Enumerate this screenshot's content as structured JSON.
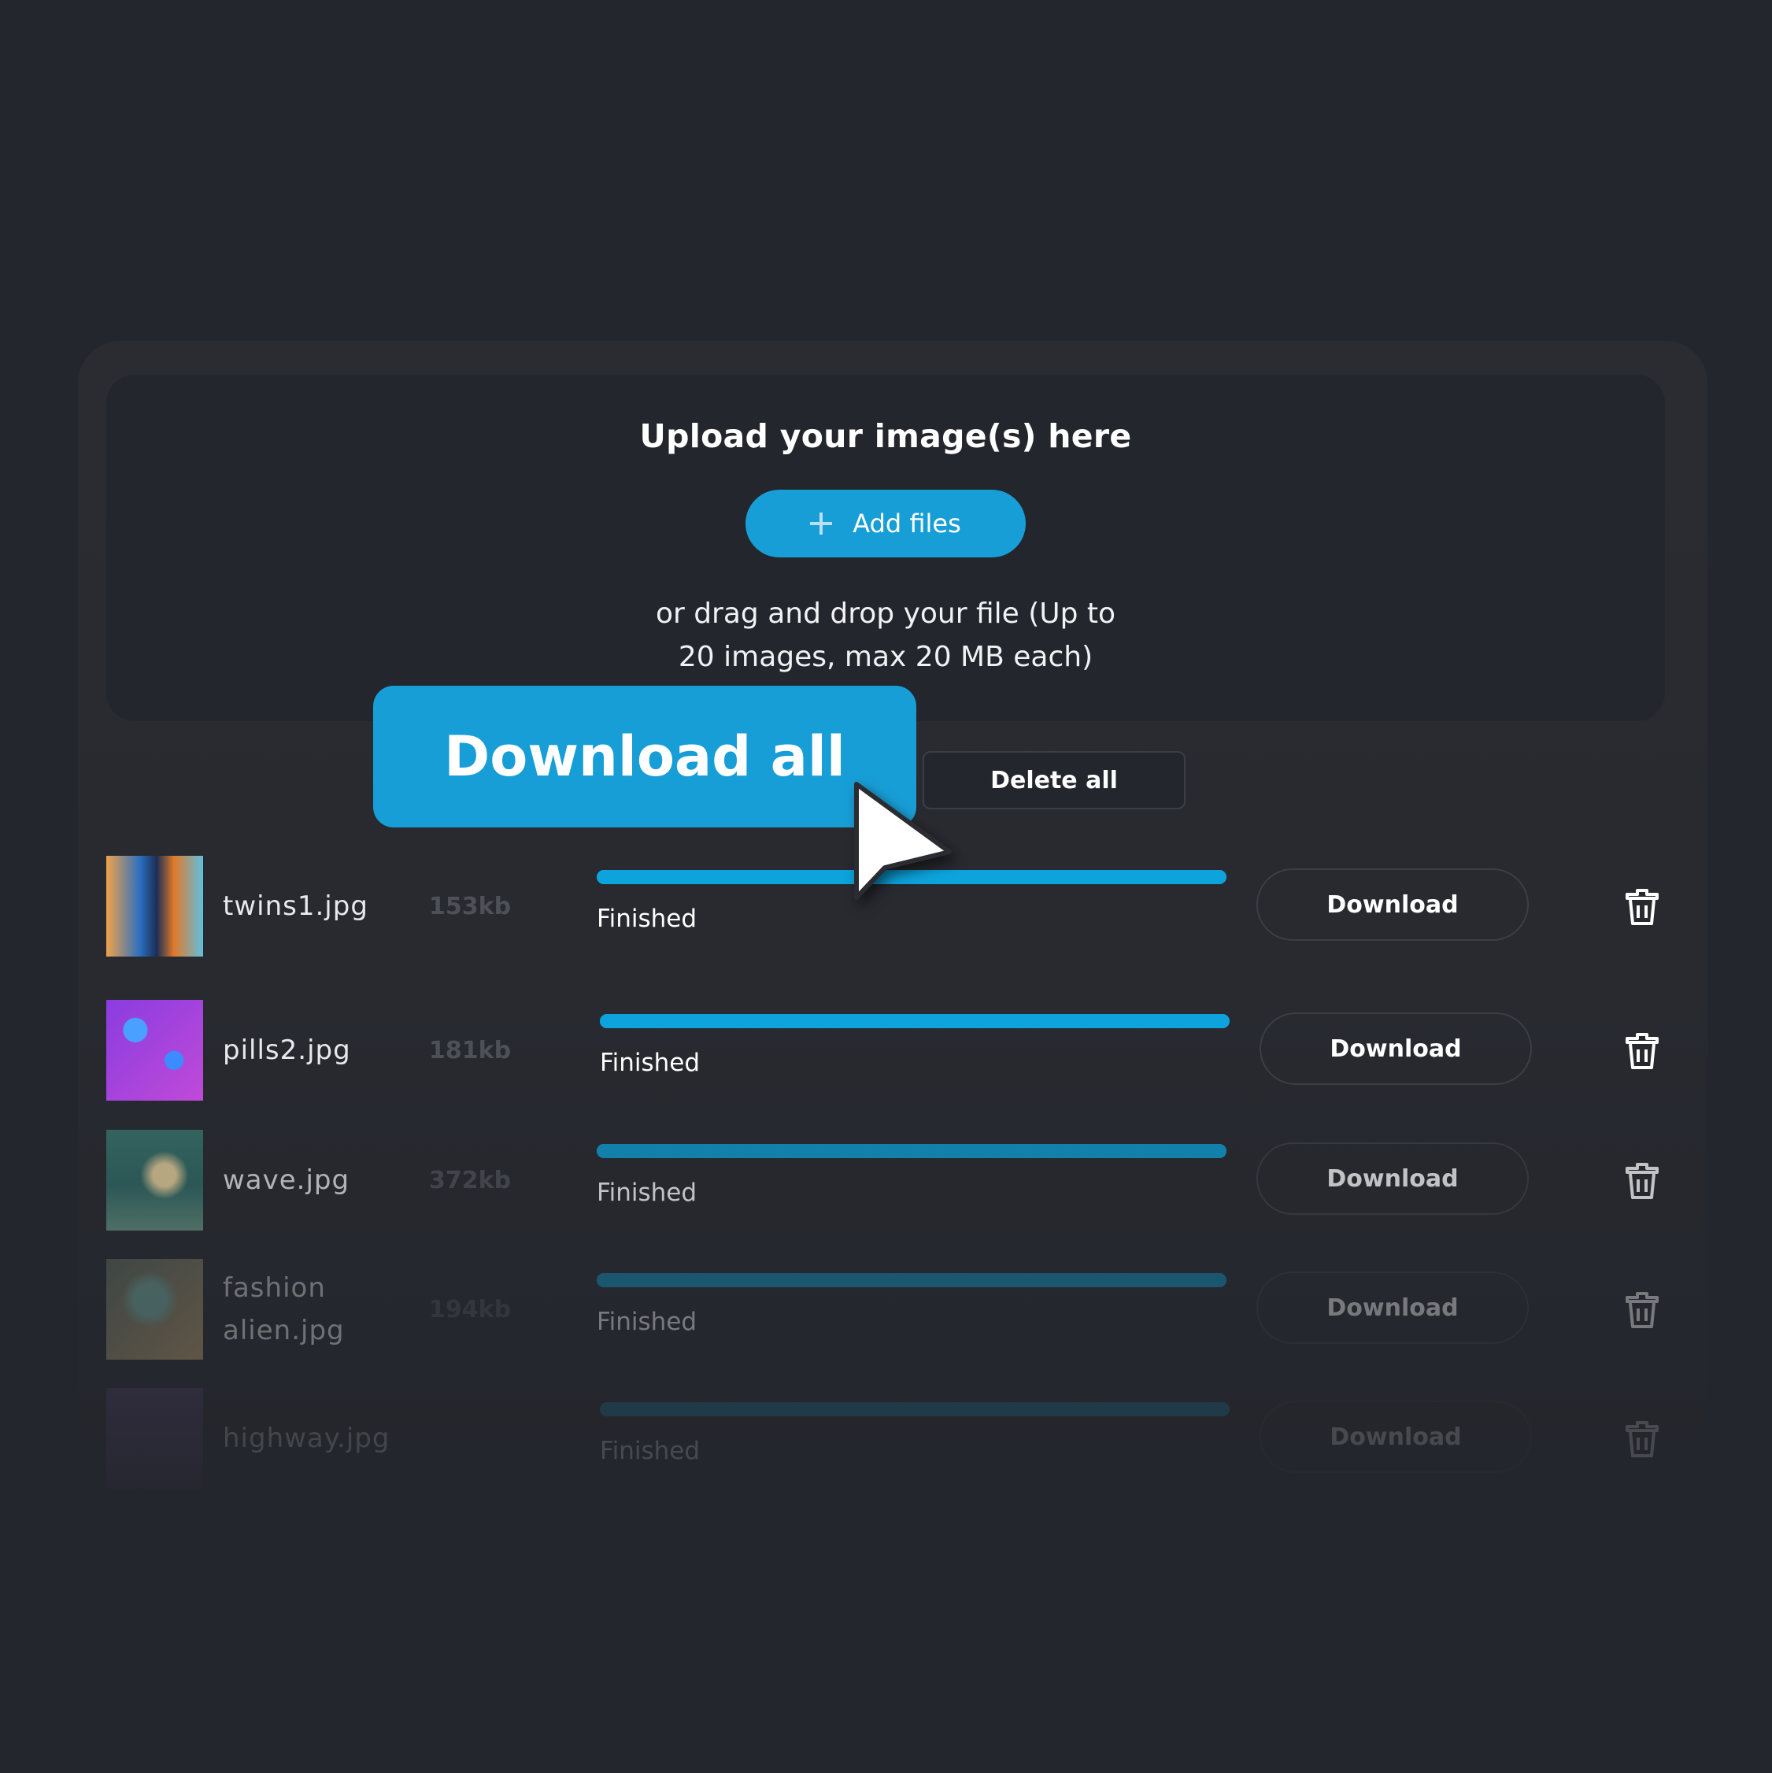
{
  "upload": {
    "title": "Upload your image(s) here",
    "add_files_label": "Add files",
    "hint": "or drag and drop your file (Up to\n20 images, max 20 MB each)"
  },
  "actions": {
    "download_all_label": "Download all",
    "delete_all_label": "Delete all"
  },
  "colors": {
    "accent": "#189ed6",
    "background": "#23262c",
    "panel": "#2a2c32"
  },
  "files": [
    {
      "name": "twins1.jpg",
      "size": "153kb",
      "status": "Finished",
      "progress": 1.0,
      "download_label": "Download",
      "thumbnail": "twins-portrait-image"
    },
    {
      "name": "pills2.jpg",
      "size": "181kb",
      "status": "Finished",
      "progress": 1.0,
      "download_label": "Download",
      "thumbnail": "pills-image"
    },
    {
      "name": "wave.jpg",
      "size": "372kb",
      "status": "Finished",
      "progress": 1.0,
      "download_label": "Download",
      "thumbnail": "wave-image"
    },
    {
      "name": "fashion alien.jpg",
      "size": "194kb",
      "status": "Finished",
      "progress": 1.0,
      "download_label": "Download",
      "thumbnail": "fashion-alien-image"
    },
    {
      "name": "highway.jpg",
      "size": "",
      "status": "Finished",
      "progress": 1.0,
      "download_label": "Download",
      "thumbnail": "highway-image"
    }
  ],
  "icons": {
    "add": "plus-icon",
    "delete": "trash-icon",
    "pointer": "mouse-cursor-icon"
  }
}
